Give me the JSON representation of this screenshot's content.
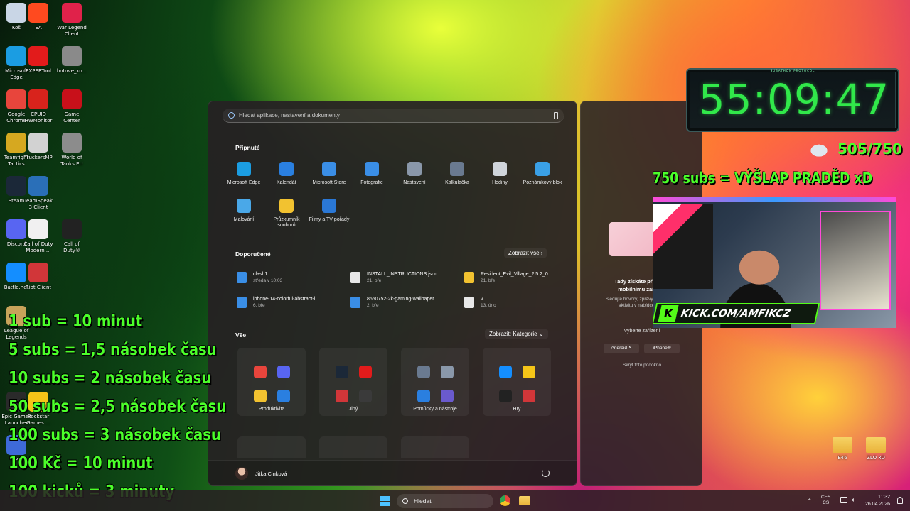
{
  "desktop_icons": [
    {
      "label": "Koš",
      "icon": "recycle-bin-icon",
      "color": "#c9d6e6"
    },
    {
      "label": "EA",
      "icon": "ea-icon",
      "color": "#ff4a1f"
    },
    {
      "label": "War Legend Client",
      "icon": "war-legend-icon",
      "color": "#e0224a"
    },
    {
      "label": "Microsoft Edge",
      "icon": "edge-icon",
      "color": "#1b9de2"
    },
    {
      "label": "EXPERTool",
      "icon": "expertool-icon",
      "color": "#e21b1b"
    },
    {
      "label": "hotove_ko...",
      "icon": "image-file-icon",
      "color": "#8a8a8a"
    },
    {
      "label": "Google Chrome",
      "icon": "chrome-icon",
      "color": "#e8453c"
    },
    {
      "label": "CPUID HWMonitor",
      "icon": "hwmonitor-icon",
      "color": "#d8231c"
    },
    {
      "label": "Game Center",
      "icon": "game-center-icon",
      "color": "#c8101a"
    },
    {
      "label": "Teamfight Tactics",
      "icon": "tft-icon",
      "color": "#d6a820"
    },
    {
      "label": "TruckersMP",
      "icon": "truckersmp-icon",
      "color": "#d2d2d2"
    },
    {
      "label": "World of Tanks EU",
      "icon": "wot-icon",
      "color": "#8c8c8c"
    },
    {
      "label": "Steam",
      "icon": "steam-icon",
      "color": "#1b2838"
    },
    {
      "label": "TeamSpeak 3 Client",
      "icon": "teamspeak-icon",
      "color": "#2a6fb8"
    },
    {
      "label": "Discord",
      "icon": "discord-icon",
      "color": "#5865f2"
    },
    {
      "label": "Call of Duty Modern ...",
      "icon": "document-icon",
      "color": "#f0f0f0"
    },
    {
      "label": "Call of Duty®",
      "icon": "cod-icon",
      "color": "#222222"
    },
    {
      "label": "Battle.net",
      "icon": "battlenet-icon",
      "color": "#148eff"
    },
    {
      "label": "Riot Client",
      "icon": "riot-icon",
      "color": "#d13639"
    },
    {
      "label": "League of Legends",
      "icon": "lol-icon",
      "color": "#c8a35a"
    },
    {
      "label": "Epic Games Launcher",
      "icon": "epic-icon",
      "color": "#2a2a2a"
    },
    {
      "label": "Rockstar Games ...",
      "icon": "rockstar-icon",
      "color": "#f5c518"
    },
    {
      "label": "CPU",
      "icon": "cpu-icon",
      "color": "#3e6ad8"
    }
  ],
  "right_desktop_icons": [
    {
      "label": "E46",
      "icon": "folder-icon"
    },
    {
      "label": "ZLO xD",
      "icon": "folder-icon"
    }
  ],
  "start_menu": {
    "search_placeholder": "Hledat aplikace, nastavení a dokumenty",
    "pinned_title": "Připnuté",
    "pinned": [
      {
        "label": "Microsoft Edge",
        "color": "#1b9de2",
        "icon": "edge-icon"
      },
      {
        "label": "Kalendář",
        "color": "#2a7fe0",
        "icon": "calendar-icon"
      },
      {
        "label": "Microsoft Store",
        "color": "#3a8ee6",
        "icon": "store-icon"
      },
      {
        "label": "Fotografie",
        "color": "#3a8ee6",
        "icon": "photos-icon"
      },
      {
        "label": "Nastavení",
        "color": "#8a98aa",
        "icon": "gear-icon"
      },
      {
        "label": "Kalkulačka",
        "color": "#6a7a90",
        "icon": "calculator-icon"
      },
      {
        "label": "Hodiny",
        "color": "#cfd4da",
        "icon": "clock-icon"
      },
      {
        "label": "Poznámkový blok",
        "color": "#3aa0e6",
        "icon": "notepad-icon"
      },
      {
        "label": "Malování",
        "color": "#4aa8e8",
        "icon": "paint-icon"
      },
      {
        "label": "Průzkumník souborů",
        "color": "#f2c230",
        "icon": "folder-icon"
      },
      {
        "label": "Filmy a TV pořady",
        "color": "#2a78d6",
        "icon": "movies-icon"
      }
    ],
    "recommended_title": "Doporučené",
    "recommended_link": "Zobrazit vše",
    "recommended": [
      {
        "name": "clash1",
        "sub": "středa v 10:03",
        "icon": "image-file-icon",
        "color": "#3a8ee6"
      },
      {
        "name": "INSTALL_INSTRUCTIONS.json",
        "sub": "21. bře",
        "icon": "document-icon",
        "color": "#e8e8e8"
      },
      {
        "name": "Resident_Evil_Village_2.5.2_0...",
        "sub": "21. bře",
        "icon": "folder-icon",
        "color": "#f2c230"
      },
      {
        "name": "iphone-14-colorful-abstract-i...",
        "sub": "6. bře",
        "icon": "image-file-icon",
        "color": "#3a8ee6"
      },
      {
        "name": "8650752-2k-gaming-wallpaper",
        "sub": "2. bře",
        "icon": "image-file-icon",
        "color": "#3a8ee6"
      },
      {
        "name": "v",
        "sub": "13. úno",
        "icon": "video-file-icon",
        "color": "#e8e8e8"
      }
    ],
    "all_title": "Vše",
    "all_link": "Zobrazit: Kategorie",
    "folders": [
      {
        "label": "Produktivita",
        "colors": [
          "#e8453c",
          "#5865f2",
          "#f2c230",
          "#2a7fe0"
        ]
      },
      {
        "label": "Jiný",
        "colors": [
          "#1b2838",
          "#e21b1b",
          "#d13639",
          "#3a3a3a"
        ]
      },
      {
        "label": "Pomůcky a nástroje",
        "colors": [
          "#6a7a90",
          "#8a98aa",
          "#2a7fe0",
          "#6a5acd"
        ]
      },
      {
        "label": "Hry",
        "colors": [
          "#148eff",
          "#f5c518",
          "#222222",
          "#d13639"
        ]
      }
    ],
    "user_name": "Jitka Cinková"
  },
  "side_panel": {
    "heading": "Tady získáte přístup k mobilnímu zařízení",
    "body": "Sledujte hovory, zprávy a nedávnou aktivitu v nabídce Start",
    "choose": "Vyberte zařízení",
    "btn_android": "Android™",
    "btn_iphone": "iPhone®",
    "hide": "Skrýt toto podokno"
  },
  "stream_overlay": {
    "timer_header": "SUBATHON PROTOCOL",
    "timer": "55:09:47",
    "subs_progress": "505/750",
    "goal": "750 subs = VÝŠLAP PRADĚD xD",
    "kick_url": "KICK.COM/AMFIKCZ",
    "rules": [
      "1 sub = 10 minut",
      "5 subs = 1,5 násobek času",
      "10 subs = 2 násobek času",
      "50 subs = 2,5 násobek času",
      "100 subs = 3 násobek času",
      "100 Kč = 10 minut",
      "100 kicků = 3 minuty"
    ]
  },
  "taskbar": {
    "search_placeholder": "Hledat",
    "lang_top": "CES",
    "lang_bottom": "CS",
    "time": "11:32",
    "date": "26.04.2026"
  }
}
